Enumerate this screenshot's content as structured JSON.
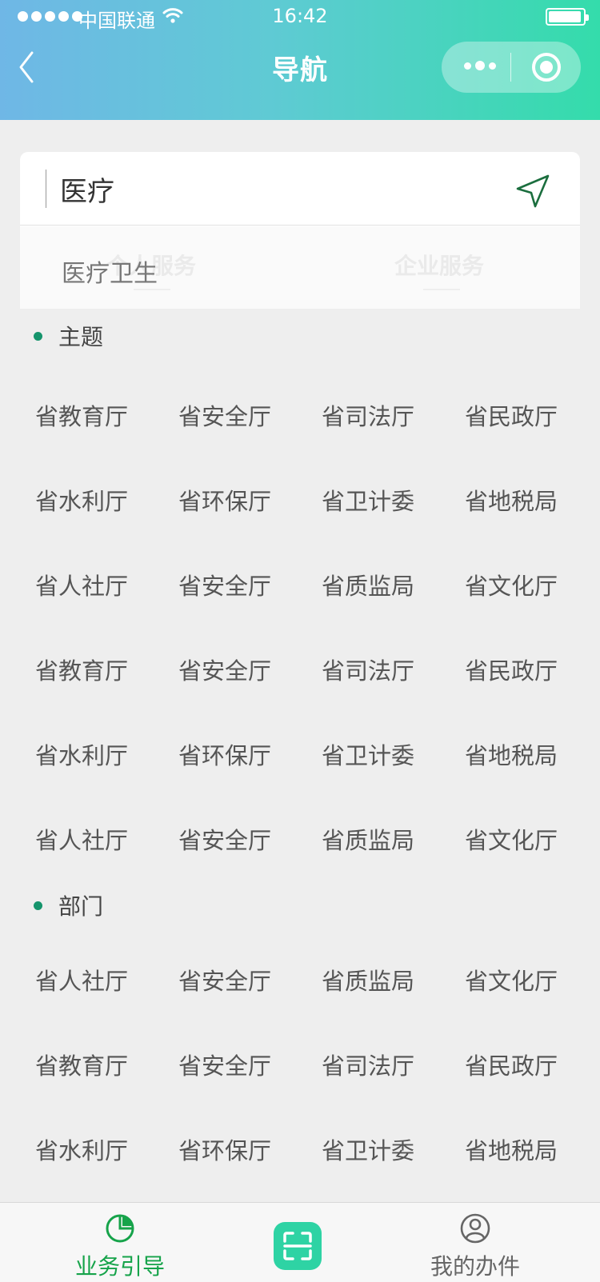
{
  "status_bar": {
    "carrier": "中国联通",
    "time": "16:42"
  },
  "header": {
    "title": "导航"
  },
  "search": {
    "value": "医疗",
    "faded_tabs": [
      "个人服务",
      "企业服务"
    ],
    "suggestion": "医疗卫生"
  },
  "sections": {
    "theme": {
      "title": "主题",
      "rows": [
        [
          "省教育厅",
          "省安全厅",
          "省司法厅",
          "省民政厅"
        ],
        [
          "省水利厅",
          "省环保厅",
          "省卫计委",
          "省地税局"
        ],
        [
          "省人社厅",
          "省安全厅",
          "省质监局",
          "省文化厅"
        ],
        [
          "省教育厅",
          "省安全厅",
          "省司法厅",
          "省民政厅"
        ],
        [
          "省水利厅",
          "省环保厅",
          "省卫计委",
          "省地税局"
        ],
        [
          "省人社厅",
          "省安全厅",
          "省质监局",
          "省文化厅"
        ]
      ]
    },
    "department": {
      "title": "部门",
      "rows": [
        [
          "省人社厅",
          "省安全厅",
          "省质监局",
          "省文化厅"
        ],
        [
          "省教育厅",
          "省安全厅",
          "省司法厅",
          "省民政厅"
        ],
        [
          "省水利厅",
          "省环保厅",
          "省卫计委",
          "省地税局"
        ]
      ]
    }
  },
  "tabbar": {
    "items": [
      {
        "label": "业务引导",
        "icon": "pie-chart-icon",
        "active": true
      },
      {
        "label": "",
        "icon": "scan-icon",
        "active": false
      },
      {
        "label": "我的办件",
        "icon": "user-icon",
        "active": false
      }
    ]
  },
  "colors": {
    "accent": "#2ed3a4",
    "active_tab": "#16a34a",
    "bullet": "#15946c",
    "locate_icon": "#1b6e3e"
  }
}
